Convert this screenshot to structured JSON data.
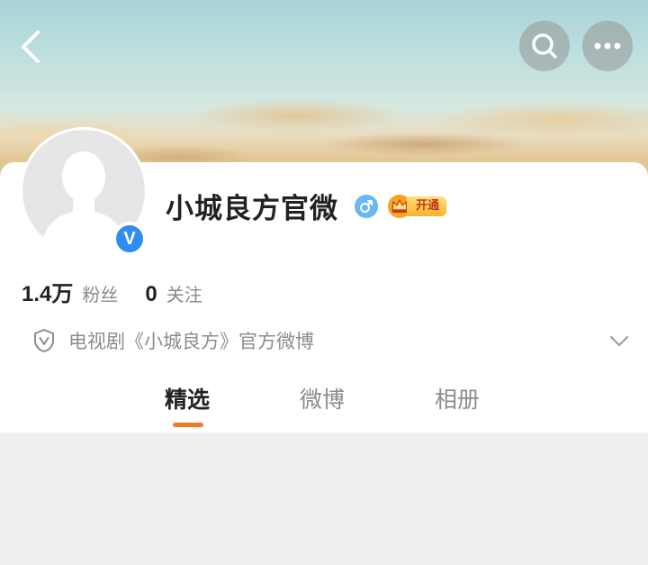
{
  "header": {
    "back_icon": "chevron-left-icon",
    "search_icon": "search-icon",
    "more_icon": "more-dots-icon"
  },
  "profile": {
    "name": "小城良方官微",
    "verified": true,
    "verified_badge_text": "V",
    "gender": "male",
    "gender_symbol": "♂",
    "vip_label": "开通",
    "stats": {
      "followers_value": "1.4万",
      "followers_label": "粉丝",
      "following_value": "0",
      "following_label": "关注"
    },
    "description": "电视剧《小城良方》官方微博"
  },
  "tabs": [
    {
      "label": "精选",
      "active": true
    },
    {
      "label": "微博",
      "active": false
    },
    {
      "label": "相册",
      "active": false
    }
  ],
  "colors": {
    "accent_orange": "#f27b2a",
    "verified_blue": "#2f8cf0",
    "gender_blue": "#69b7f5"
  }
}
